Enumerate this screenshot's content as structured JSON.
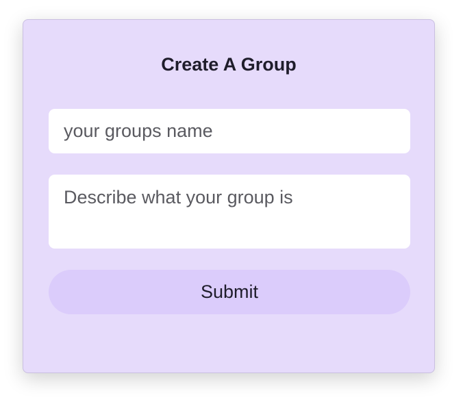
{
  "form": {
    "title": "Create A Group",
    "name_field": {
      "placeholder": "your groups name",
      "value": ""
    },
    "description_field": {
      "placeholder": "Describe what your group is",
      "value": ""
    },
    "submit_label": "Submit"
  },
  "colors": {
    "card_background": "#e6dbfb",
    "button_background": "#dbccfb",
    "field_background": "#ffffff",
    "text": "#1f1d2b"
  }
}
